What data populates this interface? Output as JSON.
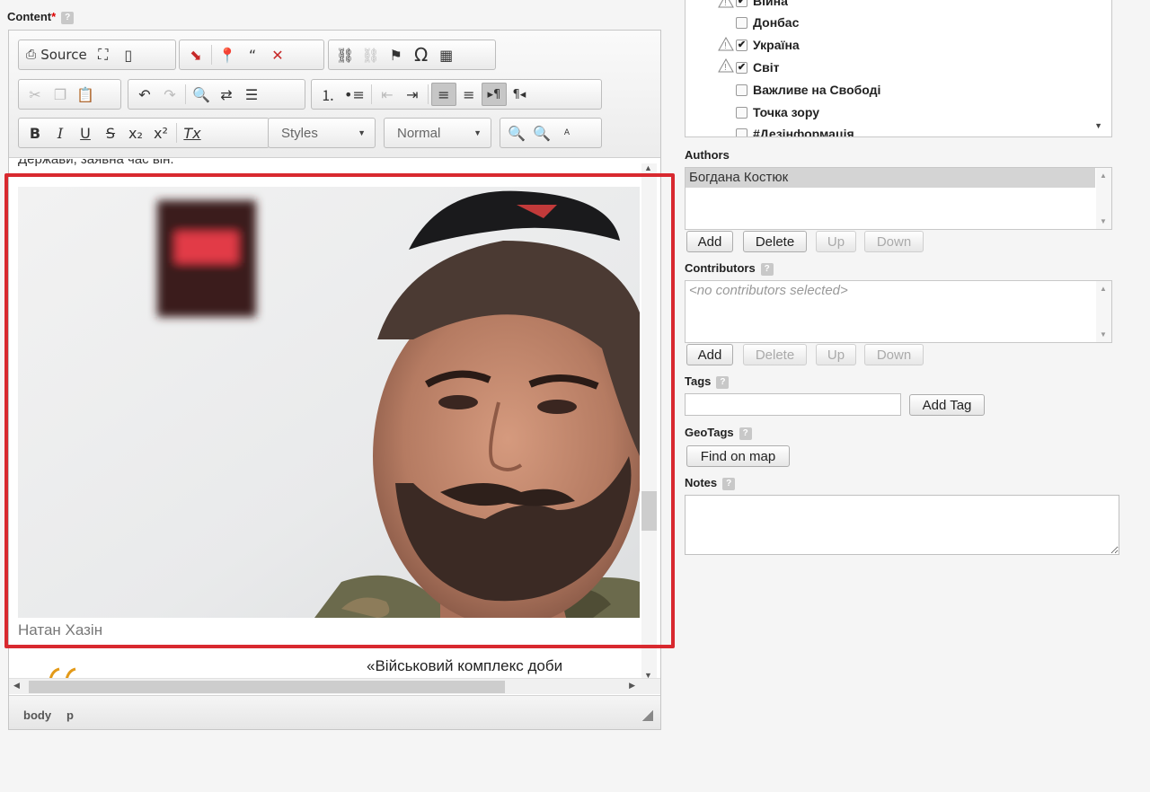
{
  "content_label": "Content",
  "content_required": "*",
  "help_glyph": "?",
  "toolbar": {
    "source_label": "Source",
    "styles_label": "Styles",
    "format_label": "Normal"
  },
  "editor": {
    "cut_text": "Держави, заявна час він.",
    "caption": "Натан Хазін",
    "quote": "«Військовий комплекс доби",
    "status_path": [
      "body",
      "p"
    ]
  },
  "categories": [
    {
      "label": "Війна",
      "checked": true,
      "warn": true
    },
    {
      "label": "Донбас",
      "checked": false,
      "warn": false
    },
    {
      "label": "Україна",
      "checked": true,
      "warn": true
    },
    {
      "label": "Світ",
      "checked": true,
      "warn": true
    },
    {
      "label": "Важливе на Свободі",
      "checked": false,
      "warn": false
    },
    {
      "label": "Точка зору",
      "checked": false,
      "warn": false
    },
    {
      "label": "#Дезінформація",
      "checked": false,
      "warn": false
    }
  ],
  "authors": {
    "label": "Authors",
    "selected": "Богдана Костюк",
    "buttons": {
      "add": "Add",
      "delete": "Delete",
      "up": "Up",
      "down": "Down"
    }
  },
  "contributors": {
    "label": "Contributors",
    "placeholder": "<no contributors selected>",
    "buttons": {
      "add": "Add",
      "delete": "Delete",
      "up": "Up",
      "down": "Down"
    }
  },
  "tags": {
    "label": "Tags",
    "value": "",
    "add_button": "Add Tag"
  },
  "geotags": {
    "label": "GeoTags",
    "find_button": "Find on map"
  },
  "notes": {
    "label": "Notes",
    "value": ""
  },
  "colors": {
    "highlight_border": "#d8292f",
    "selected_row": "#d4d4d4"
  }
}
